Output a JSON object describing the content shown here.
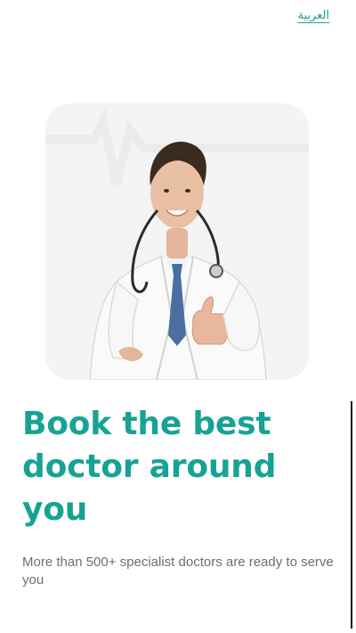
{
  "header": {
    "language_toggle_label": "العربية"
  },
  "hero": {
    "image_icon": "doctor-illustration"
  },
  "content": {
    "headline": "Book the best doctor around you",
    "subtitle": "More than 500+ specialist doctors are ready to serve you"
  },
  "colors": {
    "accent": "#17a394",
    "text_muted": "#6b6f76",
    "card_bg": "#f4f4f4"
  }
}
